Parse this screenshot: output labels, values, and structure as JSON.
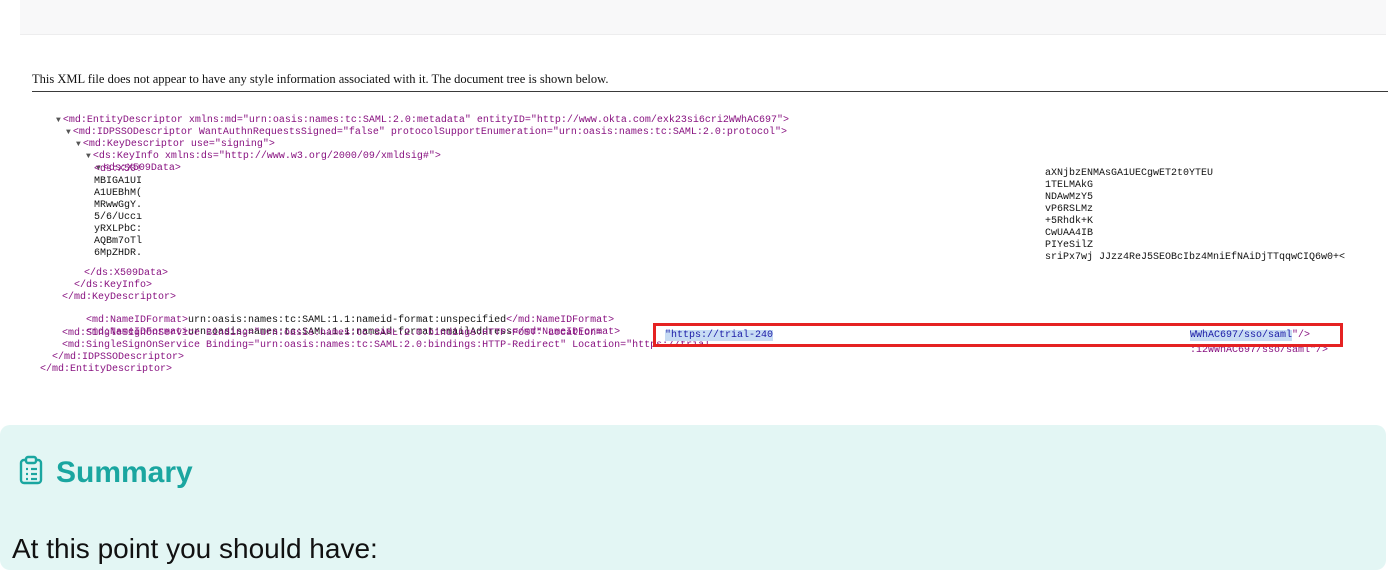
{
  "xml_notice": "This XML file does not appear to have any style information associated with it. The document tree is shown below.",
  "xml_tree": {
    "entity_descriptor_open": "<md:EntityDescriptor xmlns:md=\"urn:oasis:names:tc:SAML:2.0:metadata\" entityID=\"http://www.okta.com/exk23si6cri2WWhAC697\">",
    "idpsso_open": "<md:IDPSSODescriptor WantAuthnRequestsSigned=\"false\" protocolSupportEnumeration=\"urn:oasis:names:tc:SAML:2.0:protocol\">",
    "key_descriptor_open": "<md:KeyDescriptor use=\"signing\">",
    "key_info_open": "<ds:KeyInfo xmlns:ds=\"http://www.w3.org/2000/09/xmldsig#\">",
    "x509data_open": "<ds:X509Data>",
    "cert_lines_left": [
      "<ds:X50!",
      "MBIGA1UI",
      "A1UEBhM(",
      "MRwwGgY.",
      "5/6/Uccı",
      "yRXLPbC:",
      "AQBm7oTl",
      "6MpZHDR."
    ],
    "cert_lines_right": [
      "aXNjbzENMAsGA1UECgwET2t0YTEU",
      "1TELMAkG",
      "NDAwMzY5",
      "vP6RSLMz",
      "+5Rhdk+K",
      "CwUAA4IB",
      "PIYeSilZ",
      "sriPx7wj JJzz4ReJ5SEOBcIbz4MniEfNAiDjTTqqwCIQ6w0+<"
    ],
    "x509data_close": "</ds:X509Data>",
    "key_info_close": "</ds:KeyInfo>",
    "key_descriptor_close": "</md:KeyDescriptor>",
    "nameid_unspecified": {
      "open": "<md:NameIDFormat>",
      "value": "urn:oasis:names:tc:SAML:1.1:nameid-format:unspecified",
      "close": "</md:NameIDFormat>"
    },
    "nameid_email": {
      "open": "<md:NameIDFormat>",
      "value": "urn:oasis:names:tc:SAML:1.1:nameid-format:emailAddress",
      "close": "</md:NameIDFormat>"
    },
    "sso_post": "<md:SingleSignOnService Binding=\"urn:oasis:names:tc:SAML:2.0:bindings:HTTP-POST\" Location=",
    "sso_post_location_start": "\"https://trial-240",
    "sso_post_location_end": "WWhAC697/sso/saml",
    "sso_post_tail": "\"/>",
    "sso_redirect": "<md:SingleSignOnService Binding=\"urn:oasis:names:tc:SAML:2.0:bindings:HTTP-Redirect\" Location=\"https://trial",
    "sso_redirect_end": ":i2WWhAC697/sso/saml\"/>",
    "idpsso_close": "</md:IDPSSODescriptor>",
    "entity_descriptor_close": "</md:EntityDescriptor>"
  },
  "summary": {
    "title": "Summary",
    "body": "At this point you should have:"
  },
  "colors": {
    "summary_bg": "#e3f6f4",
    "summary_accent": "#1aa6a0",
    "highlight_box": "#e52222"
  },
  "icons": {
    "summary": "clipboard-list-icon"
  }
}
